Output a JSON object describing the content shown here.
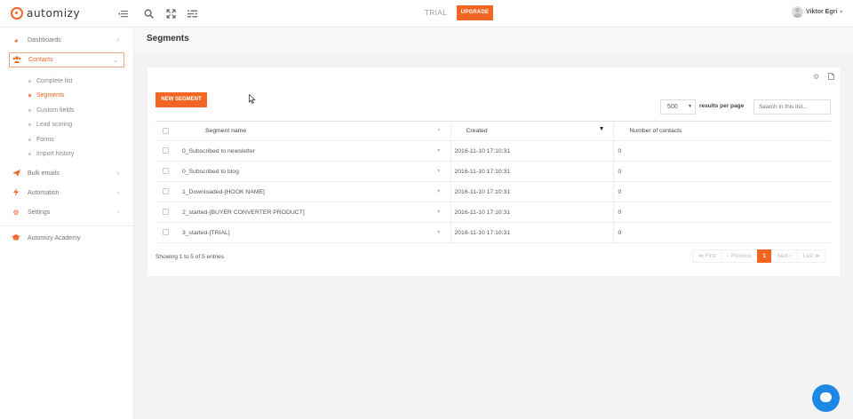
{
  "brand": {
    "name": "automizy",
    "accent": "#f26522"
  },
  "topbar": {
    "icons": [
      "sidebar-toggle-icon",
      "search-icon",
      "fullscreen-icon",
      "menu-icon"
    ],
    "plan_label": "TRIAL",
    "upgrade_label": "UPGRADE",
    "user_name": "Viktor Egri"
  },
  "sidebar": {
    "items": [
      {
        "label": "Dashboards",
        "icon": "dashboard-icon"
      },
      {
        "label": "Contacts",
        "icon": "users-icon",
        "active": true
      },
      {
        "label": "Bulk emails",
        "icon": "send-icon"
      },
      {
        "label": "Automation",
        "icon": "bolt-icon"
      },
      {
        "label": "Settings",
        "icon": "gears-icon"
      }
    ],
    "contacts_sub": [
      {
        "label": "Complete list"
      },
      {
        "label": "Segments",
        "active": true
      },
      {
        "label": "Custom fields"
      },
      {
        "label": "Lead scoring"
      },
      {
        "label": "Forms"
      },
      {
        "label": "Import history"
      }
    ],
    "academy_label": "Automizy Academy"
  },
  "main": {
    "title": "Segments",
    "new_segment_label": "NEW SEGMENT",
    "per_page_value": "500",
    "per_page_label": "results per page",
    "search_placeholder": "Search in this list...",
    "table": {
      "columns": [
        "Segment name",
        "Created",
        "Number of contacts"
      ],
      "rows": [
        {
          "name": "0_Subscribed to newsletter",
          "created": "2016-11-10 17:10:31",
          "count": "0"
        },
        {
          "name": "0_Subscribed to blog",
          "created": "2016-11-10 17:10:31",
          "count": "0"
        },
        {
          "name": "1_Downloaded-[HOOK NAME]",
          "created": "2016-11-10 17:10:31",
          "count": "0"
        },
        {
          "name": "2_started-[BUYER CONVERTER PRODUCT]",
          "created": "2016-11-10 17:10:31",
          "count": "0"
        },
        {
          "name": "3_started-[TRIAL]",
          "created": "2016-11-10 17:10:31",
          "count": "0"
        }
      ]
    },
    "info": "Showing 1 to 5 of 5 entries",
    "pager": {
      "first": "≪ First",
      "prev": "‹ Previous",
      "current": "1",
      "next": "Next ›",
      "last": "Last ≫"
    }
  }
}
